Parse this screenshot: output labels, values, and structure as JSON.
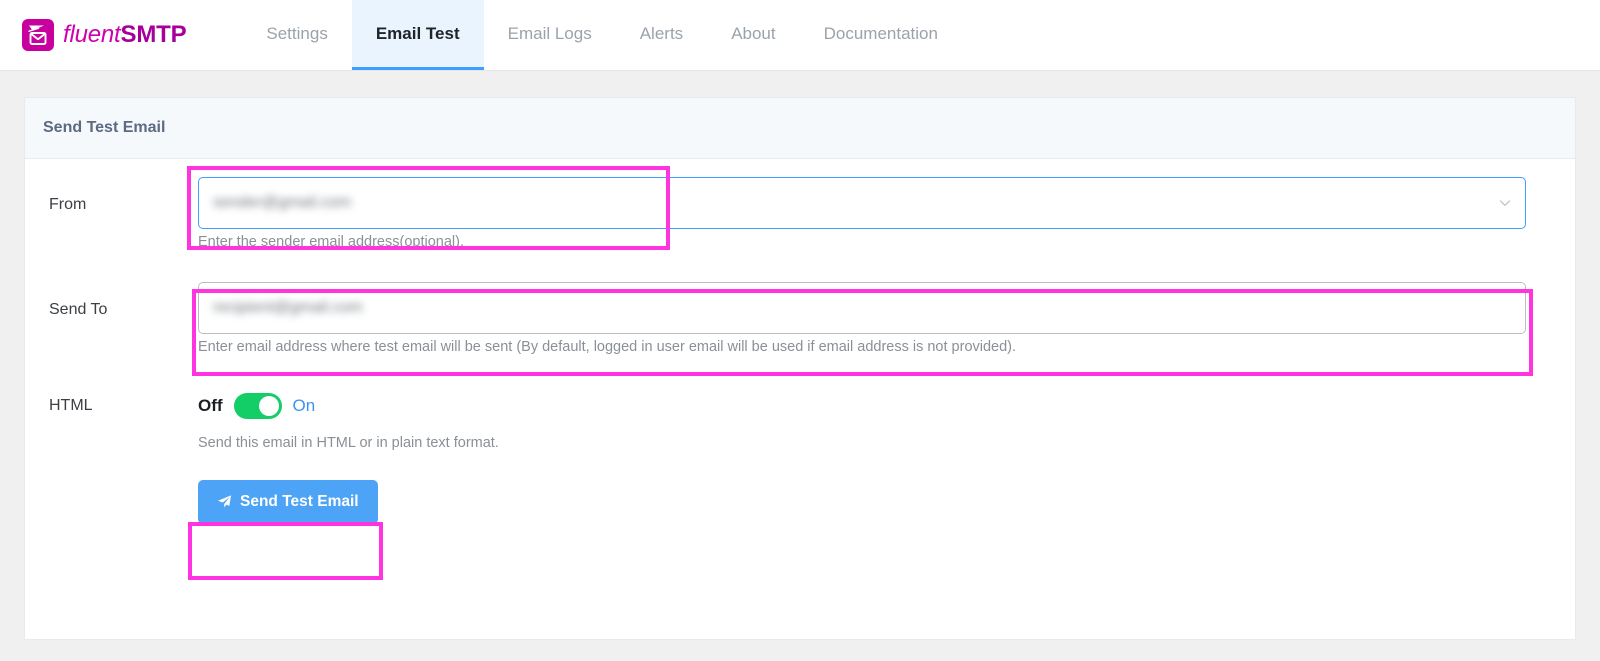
{
  "brand": {
    "icon": "envelope-plane-logo",
    "name_light": "fluent",
    "name_bold": "SMTP"
  },
  "nav": {
    "items": [
      {
        "label": "Settings",
        "active": false,
        "name": "tab-settings"
      },
      {
        "label": "Email Test",
        "active": true,
        "name": "tab-email-test"
      },
      {
        "label": "Email Logs",
        "active": false,
        "name": "tab-email-logs"
      },
      {
        "label": "Alerts",
        "active": false,
        "name": "tab-alerts"
      },
      {
        "label": "About",
        "active": false,
        "name": "tab-about"
      },
      {
        "label": "Documentation",
        "active": false,
        "name": "tab-documentation"
      }
    ]
  },
  "card": {
    "title": "Send Test Email"
  },
  "form": {
    "from": {
      "label": "From",
      "value": "sender@gmail.com",
      "help": "Enter the sender email address(optional).",
      "dropdown_icon": "chevron-down-icon"
    },
    "send_to": {
      "label": "Send To",
      "value": "recipient@gmail.com",
      "help": "Enter email address where test email will be sent (By default, logged in user email will be used if email address is not provided)."
    },
    "html": {
      "label": "HTML",
      "off_label": "Off",
      "on_label": "On",
      "state": "On",
      "help": "Send this email in HTML or in plain text format."
    },
    "submit": {
      "label": "Send Test Email",
      "icon": "paper-plane-icon"
    }
  },
  "annotations": {
    "highlight_color": "#ff33e0",
    "boxes": [
      {
        "name": "annotation-from-field"
      },
      {
        "name": "annotation-send-to-field"
      },
      {
        "name": "annotation-send-button"
      }
    ]
  },
  "colors": {
    "brand_magenta": "#c7009e",
    "accent_blue": "#409eff",
    "button_blue": "#4da3f5",
    "toggle_green": "#13ce66",
    "page_bg": "#f0f0f1",
    "card_header_bg": "#f6f9fc"
  }
}
